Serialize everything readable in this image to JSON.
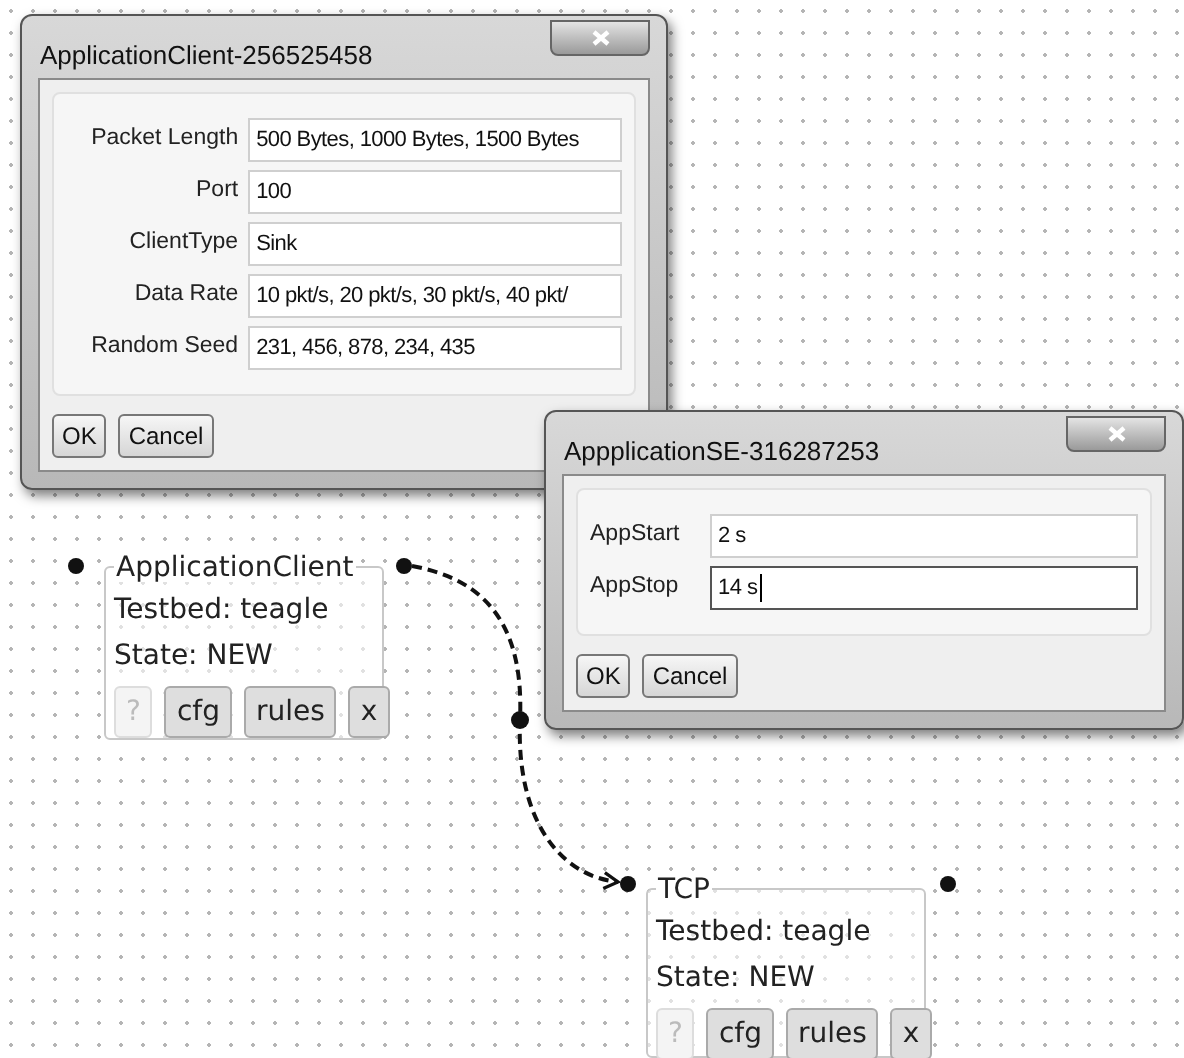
{
  "dialogs": [
    {
      "title": "ApplicationClient-256525458",
      "fields": [
        {
          "label": "Packet Length",
          "value": "500 Bytes, 1000 Bytes, 1500 Bytes",
          "focused": false
        },
        {
          "label": "Port",
          "value": "100",
          "focused": false
        },
        {
          "label": "ClientType",
          "value": "Sink",
          "focused": false
        },
        {
          "label": "Data Rate",
          "value": "10 pkt/s, 20 pkt/s, 30 pkt/s, 40 pkt/",
          "focused": false
        },
        {
          "label": "Random Seed",
          "value": "231, 456, 878, 234, 435",
          "focused": false
        }
      ],
      "buttons": [
        "OK",
        "Cancel"
      ]
    },
    {
      "title": "AppplicationSE-316287253",
      "fields": [
        {
          "label": "AppStart",
          "value": "2 s",
          "focused": false
        },
        {
          "label": "AppStop",
          "value": "14 s",
          "focused": true
        }
      ],
      "buttons": [
        "OK",
        "Cancel"
      ]
    }
  ],
  "nodes": [
    {
      "title": "ApplicationClient",
      "testbed": "Testbed: teagle",
      "state": "State: NEW",
      "buttons": [
        {
          "label": "?",
          "disabled": true
        },
        {
          "label": "cfg",
          "disabled": false
        },
        {
          "label": "rules",
          "disabled": false
        },
        {
          "label": "x",
          "disabled": false
        }
      ]
    },
    {
      "title": "TCP",
      "testbed": "Testbed: teagle",
      "state": "State: NEW",
      "buttons": [
        {
          "label": "?",
          "disabled": true
        },
        {
          "label": "cfg",
          "disabled": false
        },
        {
          "label": "rules",
          "disabled": false
        },
        {
          "label": "x",
          "disabled": false
        }
      ]
    }
  ]
}
